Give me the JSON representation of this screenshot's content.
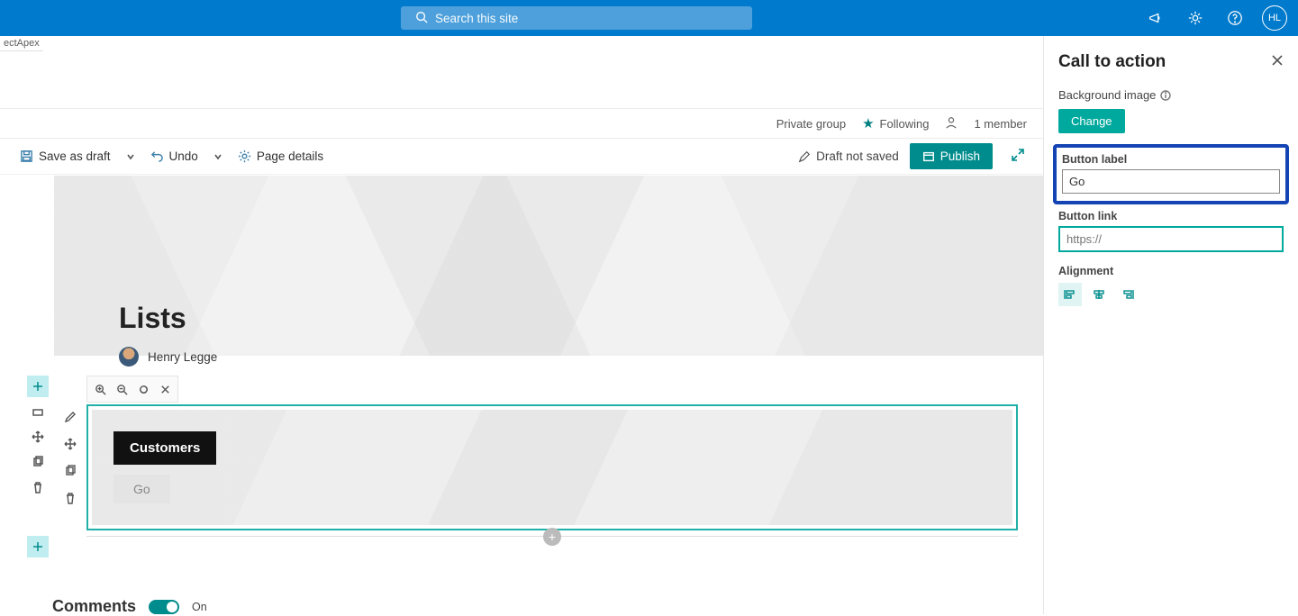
{
  "suite": {
    "search_placeholder": "Search this site",
    "avatar_initials": "HL"
  },
  "crumb_stub": "ectApex",
  "site_meta": {
    "group_type": "Private group",
    "following": "Following",
    "members": "1 member"
  },
  "cmd": {
    "save_draft": "Save as draft",
    "undo": "Undo",
    "page_details": "Page details",
    "draft_status": "Draft not saved",
    "publish": "Publish"
  },
  "hero": {
    "title": "Lists",
    "author": "Henry Legge"
  },
  "cta": {
    "title": "Customers",
    "button": "Go"
  },
  "comments": {
    "label": "Comments",
    "state": "On"
  },
  "pane": {
    "title": "Call to action",
    "bg_label": "Background image",
    "change": "Change",
    "btn_label_head": "Button label",
    "btn_label_value": "Go",
    "btn_link_head": "Button link",
    "btn_link_placeholder": "https://",
    "alignment_head": "Alignment"
  }
}
